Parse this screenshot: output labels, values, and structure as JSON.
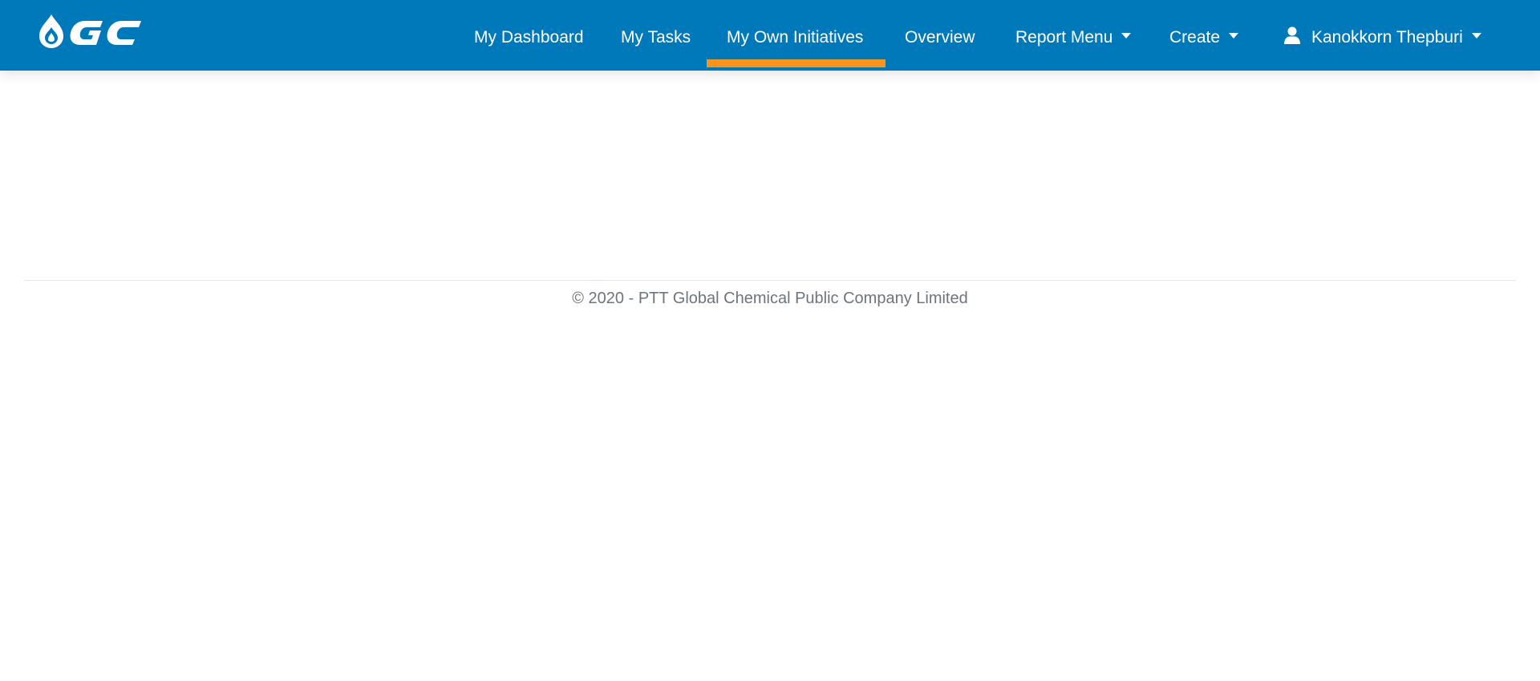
{
  "brand": {
    "logo_text": "GC",
    "colors": {
      "navbar": "#0079ba",
      "active_indicator": "#f7941d",
      "nav_text": "#ffffff",
      "footer_text": "#6c757d"
    }
  },
  "nav": {
    "items": [
      {
        "label": "My Dashboard",
        "active": false
      },
      {
        "label": "My Tasks",
        "active": false
      },
      {
        "label": "My Own Initiatives",
        "active": true
      },
      {
        "label": "Overview",
        "active": false
      },
      {
        "label": "Report Menu",
        "active": false,
        "dropdown": true
      },
      {
        "label": "Create",
        "active": false,
        "dropdown": true
      }
    ],
    "user": {
      "name": "Kanokkorn Thepburi",
      "icon": "user-icon",
      "dropdown": true
    }
  },
  "footer": {
    "text": "© 2020 - PTT Global Chemical Public Company Limited"
  }
}
